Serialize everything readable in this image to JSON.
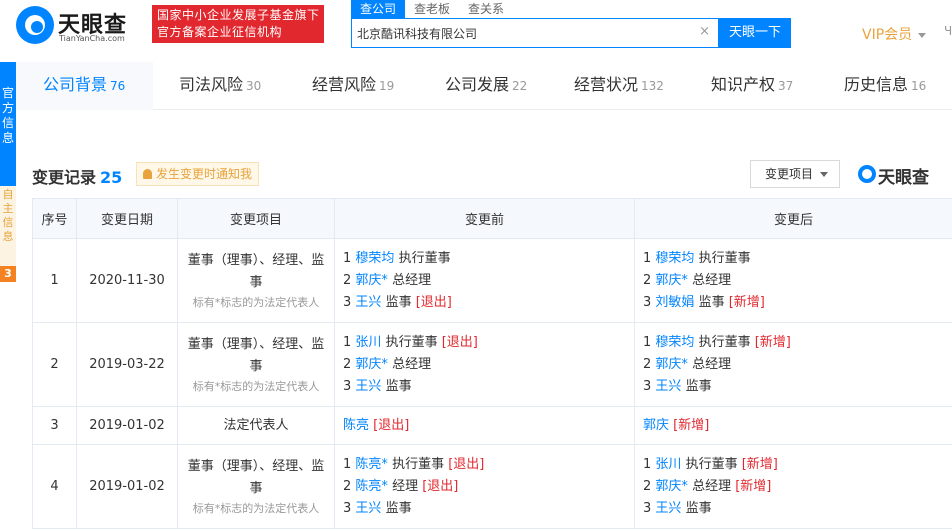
{
  "header": {
    "logo_cn": "天眼查",
    "logo_en": "TianYanCha.com",
    "gov_line1": "国家中小企业发展子基金旗下",
    "gov_line2": "官方备案企业征信机构",
    "search_tabs": [
      "查公司",
      "查老板",
      "查关系"
    ],
    "search_value": "北京酷讯科技有限公司",
    "search_clear": "×",
    "search_button": "天眼一下",
    "vip_label": "VIP会员",
    "vip_edge": "Ч"
  },
  "side_ribbon": {
    "blue_text": "官方信息",
    "light_text": "自主信息",
    "badge": "3"
  },
  "nav": [
    {
      "label": "公司背景",
      "count": "76"
    },
    {
      "label": "司法风险",
      "count": "30"
    },
    {
      "label": "经营风险",
      "count": "19"
    },
    {
      "label": "公司发展",
      "count": "22"
    },
    {
      "label": "经营状况",
      "count": "132"
    },
    {
      "label": "知识产权",
      "count": "37"
    },
    {
      "label": "历史信息",
      "count": "16"
    }
  ],
  "section": {
    "title": "变更记录",
    "count": "25",
    "notify_text": "发生变更时通知我",
    "filter_label": "变更项目",
    "watermark": "天眼查"
  },
  "table": {
    "headers": [
      "序号",
      "变更日期",
      "变更项目",
      "变更前",
      "变更后"
    ],
    "rows": [
      {
        "index": "1",
        "date": "2020-11-30",
        "item": "董事（理事）、经理、监事",
        "note": "标有*标志的为法定代表人",
        "before": [
          {
            "no": "1",
            "name": "穆荣均",
            "role": "执行董事",
            "tag": ""
          },
          {
            "no": "2",
            "name": "郭庆*",
            "role": "总经理",
            "tag": ""
          },
          {
            "no": "3",
            "name": "王兴",
            "role": "监事",
            "tag": "[退出]"
          }
        ],
        "after": [
          {
            "no": "1",
            "name": "穆荣均",
            "role": "执行董事",
            "tag": ""
          },
          {
            "no": "2",
            "name": "郭庆*",
            "role": "总经理",
            "tag": ""
          },
          {
            "no": "3",
            "name": "刘敏娟",
            "role": "监事",
            "tag": "[新增]"
          }
        ]
      },
      {
        "index": "2",
        "date": "2019-03-22",
        "item": "董事（理事）、经理、监事",
        "note": "标有*标志的为法定代表人",
        "before": [
          {
            "no": "1",
            "name": "张川",
            "role": "执行董事",
            "tag": "[退出]"
          },
          {
            "no": "2",
            "name": "郭庆*",
            "role": "总经理",
            "tag": ""
          },
          {
            "no": "3",
            "name": "王兴",
            "role": "监事",
            "tag": ""
          }
        ],
        "after": [
          {
            "no": "1",
            "name": "穆荣均",
            "role": "执行董事",
            "tag": "[新增]"
          },
          {
            "no": "2",
            "name": "郭庆*",
            "role": "总经理",
            "tag": ""
          },
          {
            "no": "3",
            "name": "王兴",
            "role": "监事",
            "tag": ""
          }
        ]
      },
      {
        "index": "3",
        "date": "2019-01-02",
        "item": "法定代表人",
        "note": "",
        "before": [
          {
            "no": "",
            "name": "陈亮",
            "role": "",
            "tag": "[退出]"
          }
        ],
        "after": [
          {
            "no": "",
            "name": "郭庆",
            "role": "",
            "tag": "[新增]"
          }
        ]
      },
      {
        "index": "4",
        "date": "2019-01-02",
        "item": "董事（理事）、经理、监事",
        "note": "标有*标志的为法定代表人",
        "before": [
          {
            "no": "1",
            "name": "陈亮*",
            "role": "执行董事",
            "tag": "[退出]"
          },
          {
            "no": "2",
            "name": "陈亮*",
            "role": "经理",
            "tag": "[退出]"
          },
          {
            "no": "3",
            "name": "王兴",
            "role": "监事",
            "tag": ""
          }
        ],
        "after": [
          {
            "no": "1",
            "name": "张川",
            "role": "执行董事",
            "tag": "[新增]"
          },
          {
            "no": "2",
            "name": "郭庆*",
            "role": "总经理",
            "tag": "[新增]"
          },
          {
            "no": "3",
            "name": "王兴",
            "role": "监事",
            "tag": ""
          }
        ]
      }
    ]
  }
}
